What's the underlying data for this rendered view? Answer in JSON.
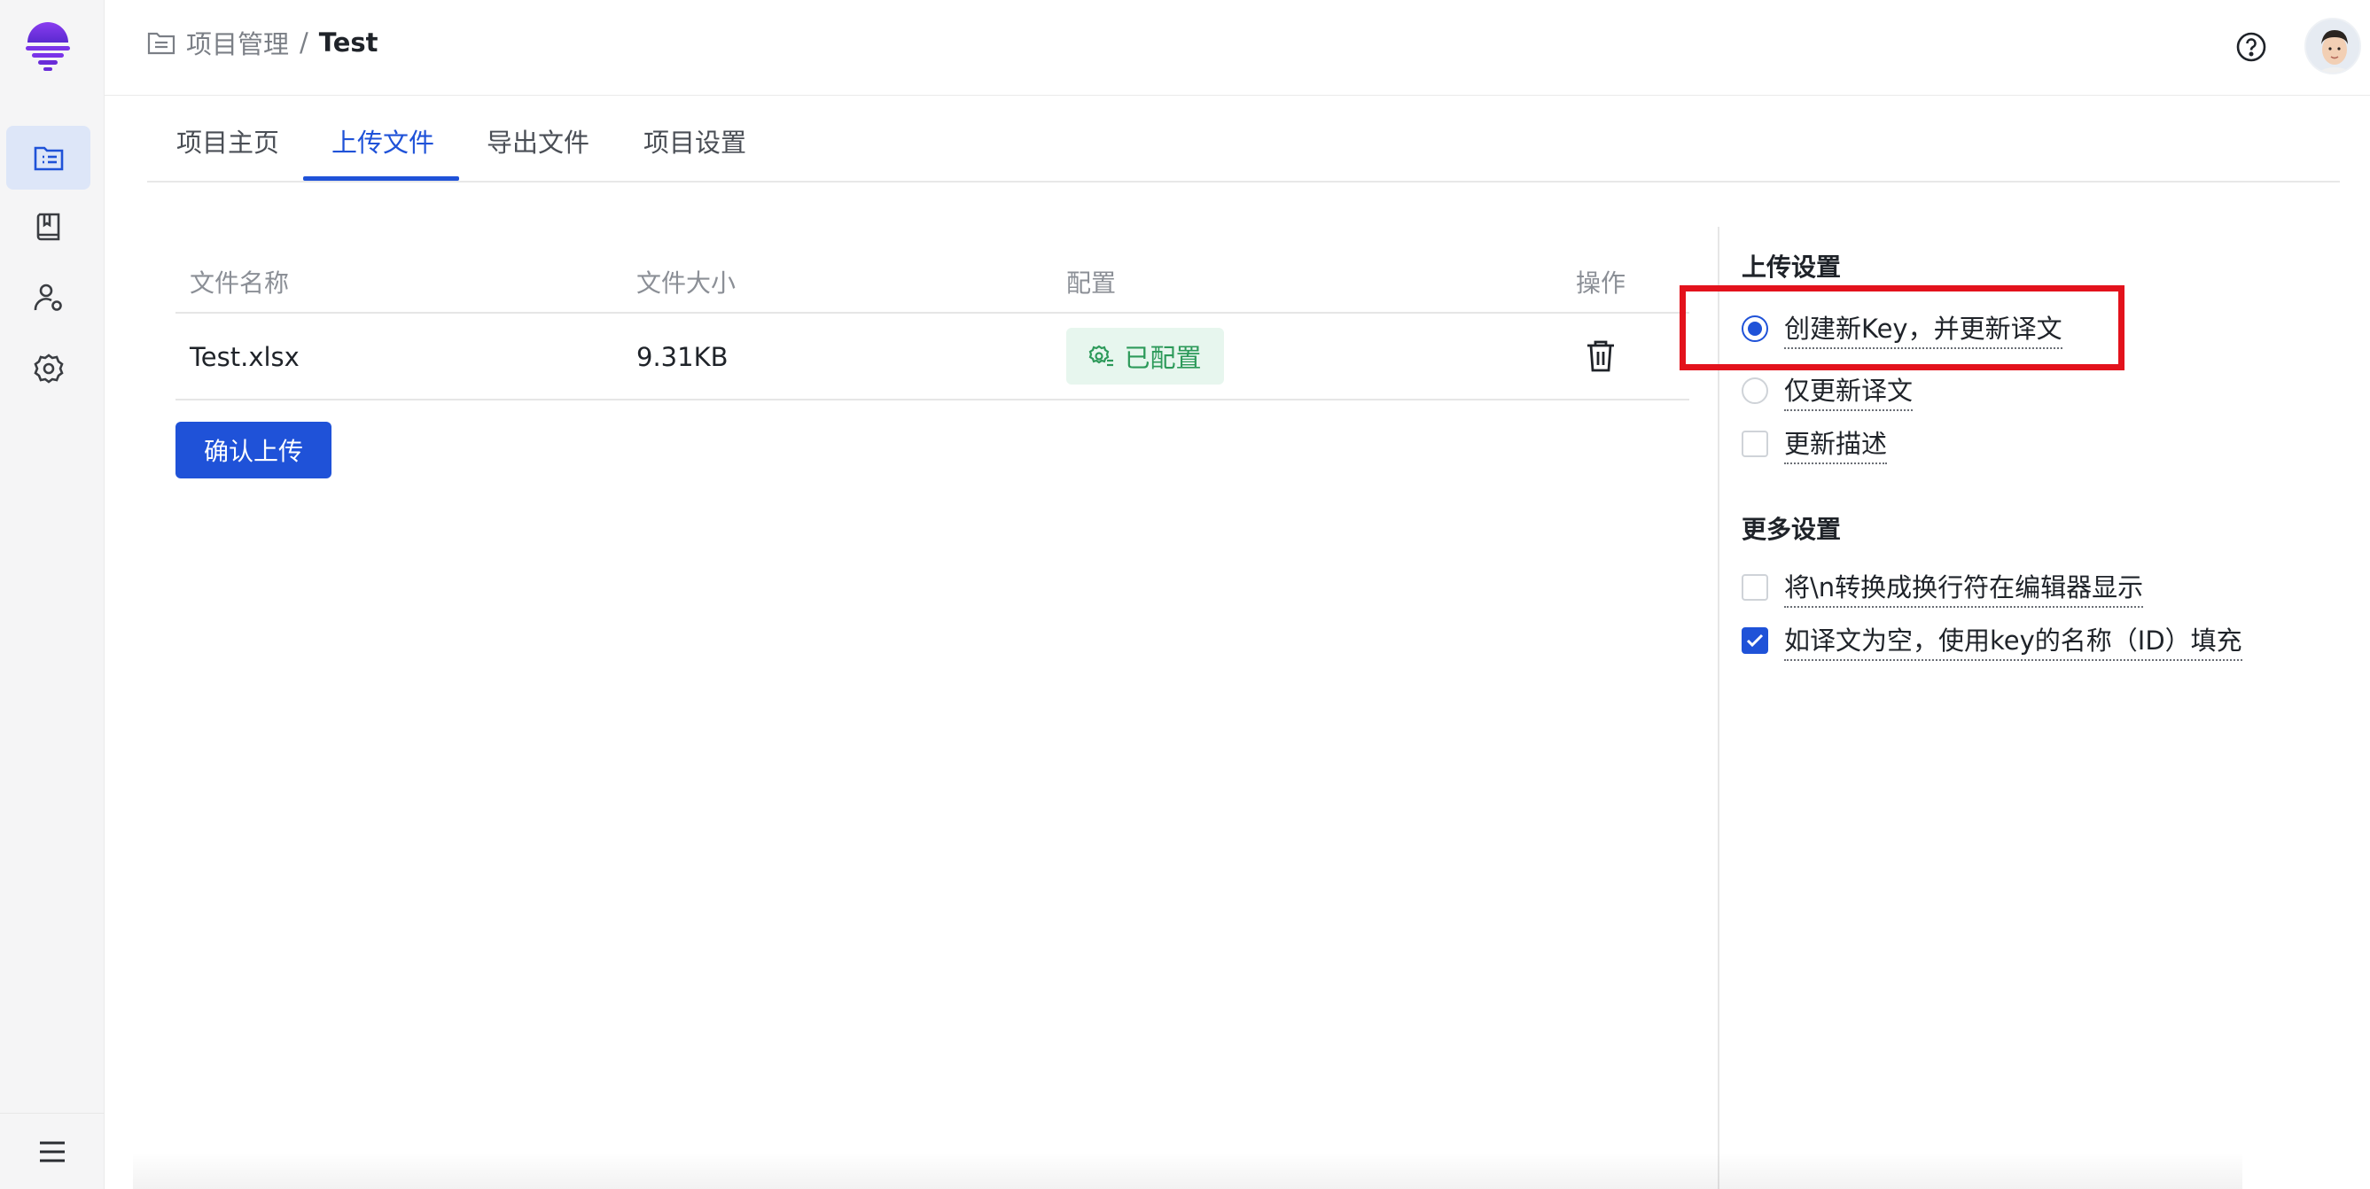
{
  "sidebar": {
    "logo": "brand-logo",
    "items": [
      {
        "icon": "project-list-icon",
        "active": true
      },
      {
        "icon": "book-icon",
        "active": false
      },
      {
        "icon": "user-settings-icon",
        "active": false
      },
      {
        "icon": "gear-icon",
        "active": false
      }
    ],
    "bottom_icon": "menu-icon"
  },
  "header": {
    "breadcrumb_icon": "folder-icon",
    "breadcrumb_parent": "项目管理",
    "breadcrumb_sep": "/",
    "breadcrumb_current": "Test",
    "help_icon": "help-icon",
    "avatar": "avatar"
  },
  "tabs": [
    {
      "label": "项目主页",
      "active": false
    },
    {
      "label": "上传文件",
      "active": true
    },
    {
      "label": "导出文件",
      "active": false
    },
    {
      "label": "项目设置",
      "active": false
    }
  ],
  "table": {
    "columns": [
      "文件名称",
      "文件大小",
      "配置",
      "操作"
    ],
    "rows": [
      {
        "name": "Test.xlsx",
        "size": "9.31KB",
        "config": "已配置"
      }
    ]
  },
  "confirm_button": "确认上传",
  "upload_settings": {
    "title": "上传设置",
    "options": [
      {
        "type": "radio",
        "label": "创建新Key，并更新译文",
        "checked": true
      },
      {
        "type": "radio",
        "label": "仅更新译文",
        "checked": false
      },
      {
        "type": "checkbox",
        "label": "更新描述",
        "checked": false
      }
    ]
  },
  "more_settings": {
    "title": "更多设置",
    "options": [
      {
        "type": "checkbox",
        "label": "将\\n转换成换行符在编辑器显示",
        "checked": false
      },
      {
        "type": "checkbox",
        "label": "如译文为空，使用key的名称（ID）填充",
        "checked": true
      }
    ]
  },
  "colors": {
    "accent": "#1f52d8",
    "success": "#2d9a5a",
    "highlight": "#e3121c",
    "brand": "#6a2cd8"
  }
}
